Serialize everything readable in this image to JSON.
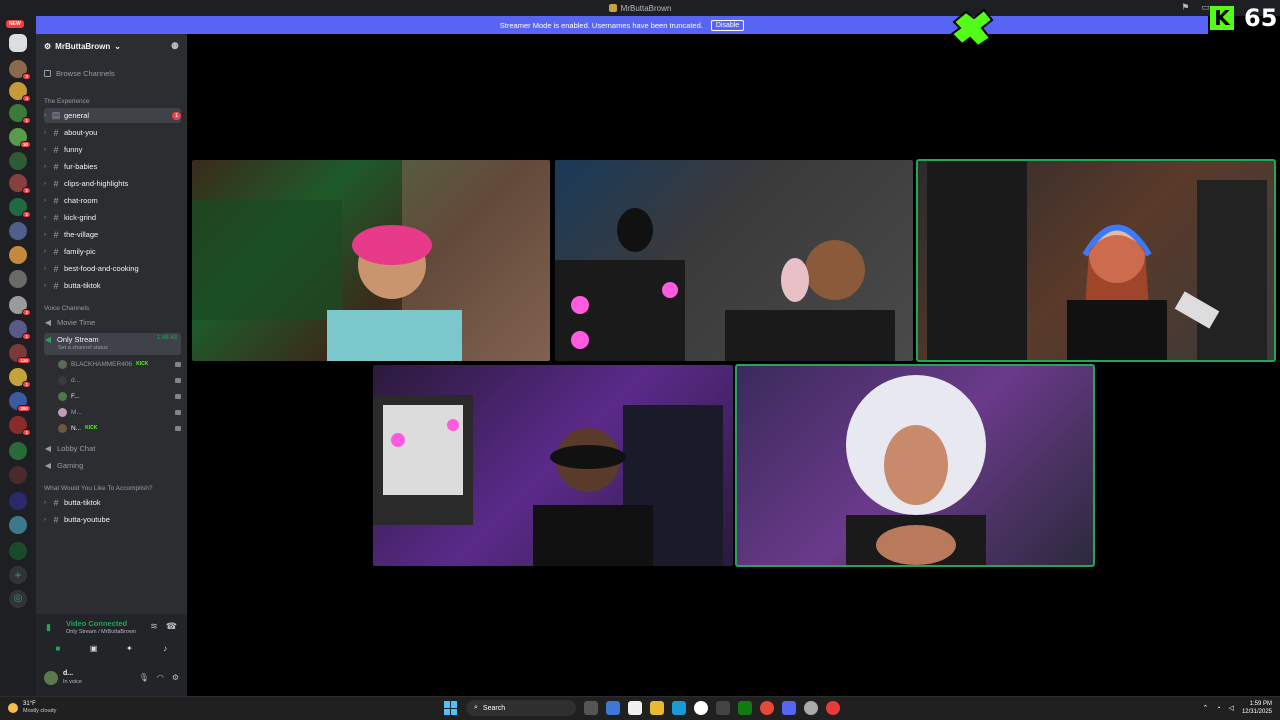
{
  "titlebar": {
    "title": "MrButtaBrown"
  },
  "banner": {
    "text": "Streamer Mode is enabled. Usernames have been truncated.",
    "disable_label": "Disable",
    "new_badge": "NEW"
  },
  "rail": {
    "badges": [
      "3",
      "4",
      "1",
      "30",
      "1",
      "1",
      "2",
      "1",
      "120",
      "1",
      "290",
      "1"
    ]
  },
  "sidebar": {
    "guild_name": "MrButtaBrown",
    "browse_label": "Browse Channels",
    "category_1": "The Experience",
    "channels": [
      {
        "name": "general",
        "unread": "1"
      },
      {
        "name": "about-you",
        "unread": ""
      },
      {
        "name": "funny",
        "unread": ""
      },
      {
        "name": "fur-babies",
        "unread": ""
      },
      {
        "name": "clips-and-highlights",
        "unread": ""
      },
      {
        "name": "chat-room",
        "unread": ""
      },
      {
        "name": "kick-grind",
        "unread": ""
      },
      {
        "name": "the-village",
        "unread": ""
      },
      {
        "name": "family-pic",
        "unread": ""
      },
      {
        "name": "best-food-and-cooking",
        "unread": ""
      },
      {
        "name": "butta-tiktok",
        "unread": ""
      }
    ],
    "voice_category": "Voice Channels",
    "voice_channels": {
      "movie_time": "Movie Time",
      "only_stream": "Only Stream",
      "only_stream_timer": "1:48:43",
      "only_stream_status": "Set a channel status",
      "lobby_chat": "Lobby Chat",
      "gaming": "Gaming"
    },
    "members": [
      {
        "name": "BLACKHAMMER406",
        "kick": "KICK"
      },
      {
        "name": "d...",
        "kick": ""
      },
      {
        "name": "F...",
        "kick": ""
      },
      {
        "name": "M...",
        "kick": ""
      },
      {
        "name": "N...",
        "kick": "KICK"
      }
    ],
    "category_2": "What Would You Like To Accomplish?",
    "channels_2": [
      {
        "name": "butta-tiktok"
      },
      {
        "name": "butta-youtube"
      }
    ]
  },
  "voice_panel": {
    "title": "Video Connected",
    "subtitle": "Only Stream / MrButtaBrown"
  },
  "user_panel": {
    "name": "d...",
    "status": "In voice"
  },
  "kick_overlay": {
    "count": "65",
    "logo": "K"
  },
  "taskbar": {
    "weather_temp": "31°F",
    "weather_cond": "Mostly cloudy",
    "search_placeholder": "Search",
    "time": "1:59 PM",
    "date": "12/31/2025"
  },
  "colors": {
    "accent": "#5865f2",
    "speaking": "#23a55a",
    "kick": "#53fc18",
    "danger": "#f23f43"
  }
}
